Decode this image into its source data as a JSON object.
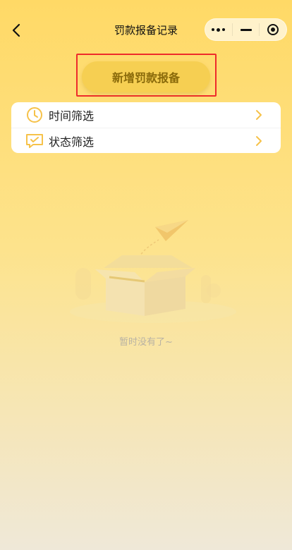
{
  "navbar": {
    "title": "罚款报备记录",
    "back_icon": "chevron-left-icon",
    "capsule": {
      "more_icon": "more-dots-icon",
      "minimize_icon": "minimize-icon",
      "close_icon": "target-circle-icon"
    }
  },
  "actions": {
    "add_label": "新增罚款报备",
    "highlight_color": "#ee2b2b",
    "button_color": "#f6cf52"
  },
  "filters": [
    {
      "label": "时间筛选",
      "icon": "clock-icon"
    },
    {
      "label": "状态筛选",
      "icon": "chat-check-icon"
    }
  ],
  "empty": {
    "text": "暂时没有了~",
    "illustration": "empty-box-paper-plane-icon"
  },
  "colors": {
    "accent": "#f6c24a",
    "background_top": "#ffd966",
    "background_bottom": "#efe8d8"
  }
}
